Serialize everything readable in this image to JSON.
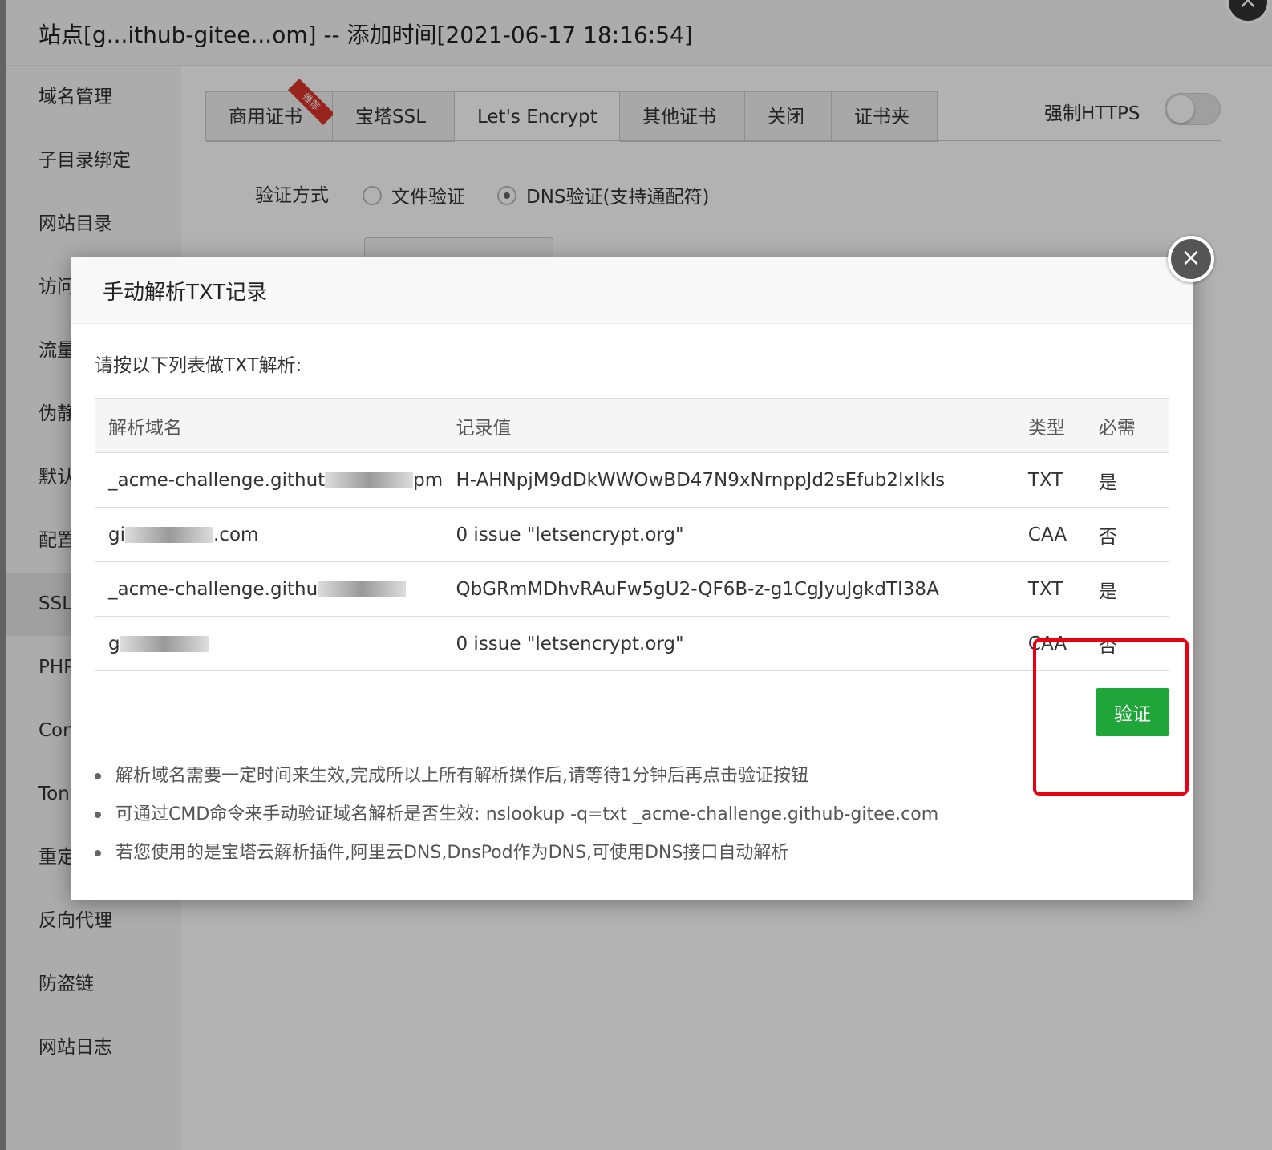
{
  "window": {
    "title": "站点[g...ithub-gitee...om] -- 添加时间[2021-06-17 18:16:54]",
    "close_icon": "×"
  },
  "sidebar": {
    "items": [
      {
        "label": "域名管理"
      },
      {
        "label": "子目录绑定"
      },
      {
        "label": "网站目录"
      },
      {
        "label": "访问"
      },
      {
        "label": "流量"
      },
      {
        "label": "伪静"
      },
      {
        "label": "默认"
      },
      {
        "label": "配置"
      },
      {
        "label": "SSL"
      },
      {
        "label": "PHP"
      },
      {
        "label": "Con"
      },
      {
        "label": "Ton"
      },
      {
        "label": "重定"
      },
      {
        "label": "反向代理"
      },
      {
        "label": "防盗链"
      },
      {
        "label": "网站日志"
      }
    ]
  },
  "ssl": {
    "tabs": [
      {
        "label": "商用证书",
        "ribbon": "推荐"
      },
      {
        "label": "宝塔SSL"
      },
      {
        "label": "Let's Encrypt"
      },
      {
        "label": "其他证书"
      },
      {
        "label": "关闭"
      },
      {
        "label": "证书夹"
      }
    ],
    "force_https_label": "强制HTTPS",
    "verify_method_label": "验证方式",
    "options": [
      {
        "label": "文件验证"
      },
      {
        "label": "DNS验证(支持通配符)"
      }
    ]
  },
  "modal": {
    "title": "手动解析TXT记录",
    "close_icon": "×",
    "instruction": "请按以下列表做TXT解析:",
    "table": {
      "headers": [
        "解析域名",
        "记录值",
        "类型",
        "必需"
      ],
      "rows": [
        {
          "domain": "_acme-challenge.githut",
          "domain_tail": "pm",
          "value": "H-AHNpjM9dDkWWOwBD47N9xNrnppJd2sEfub2lxlkls",
          "type": "TXT",
          "required": "是"
        },
        {
          "domain": "gi",
          "domain_tail": ".com",
          "value": "0 issue \"letsencrypt.org\"",
          "type": "CAA",
          "required": "否"
        },
        {
          "domain": "_acme-challenge.githu",
          "domain_tail": "",
          "value": "QbGRmMDhvRAuFw5gU2-QF6B-z-g1CgJyuJgkdTI38A",
          "type": "TXT",
          "required": "是"
        },
        {
          "domain": "g",
          "domain_tail": "",
          "value": "0 issue \"letsencrypt.org\"",
          "type": "CAA",
          "required": "否"
        }
      ]
    },
    "verify_button": "验证",
    "notes": [
      "解析域名需要一定时间来生效,完成所以上所有解析操作后,请等待1分钟后再点击验证按钮",
      "可通过CMD命令来手动验证域名解析是否生效: nslookup -q=txt _acme-challenge.github-gitee.com",
      "若您使用的是宝塔云解析插件,阿里云DNS,DnsPod作为DNS,可使用DNS接口自动解析"
    ]
  },
  "colors": {
    "primary_green": "#20a53a",
    "highlight_red": "#e60012",
    "ribbon_red": "#d9352c"
  }
}
